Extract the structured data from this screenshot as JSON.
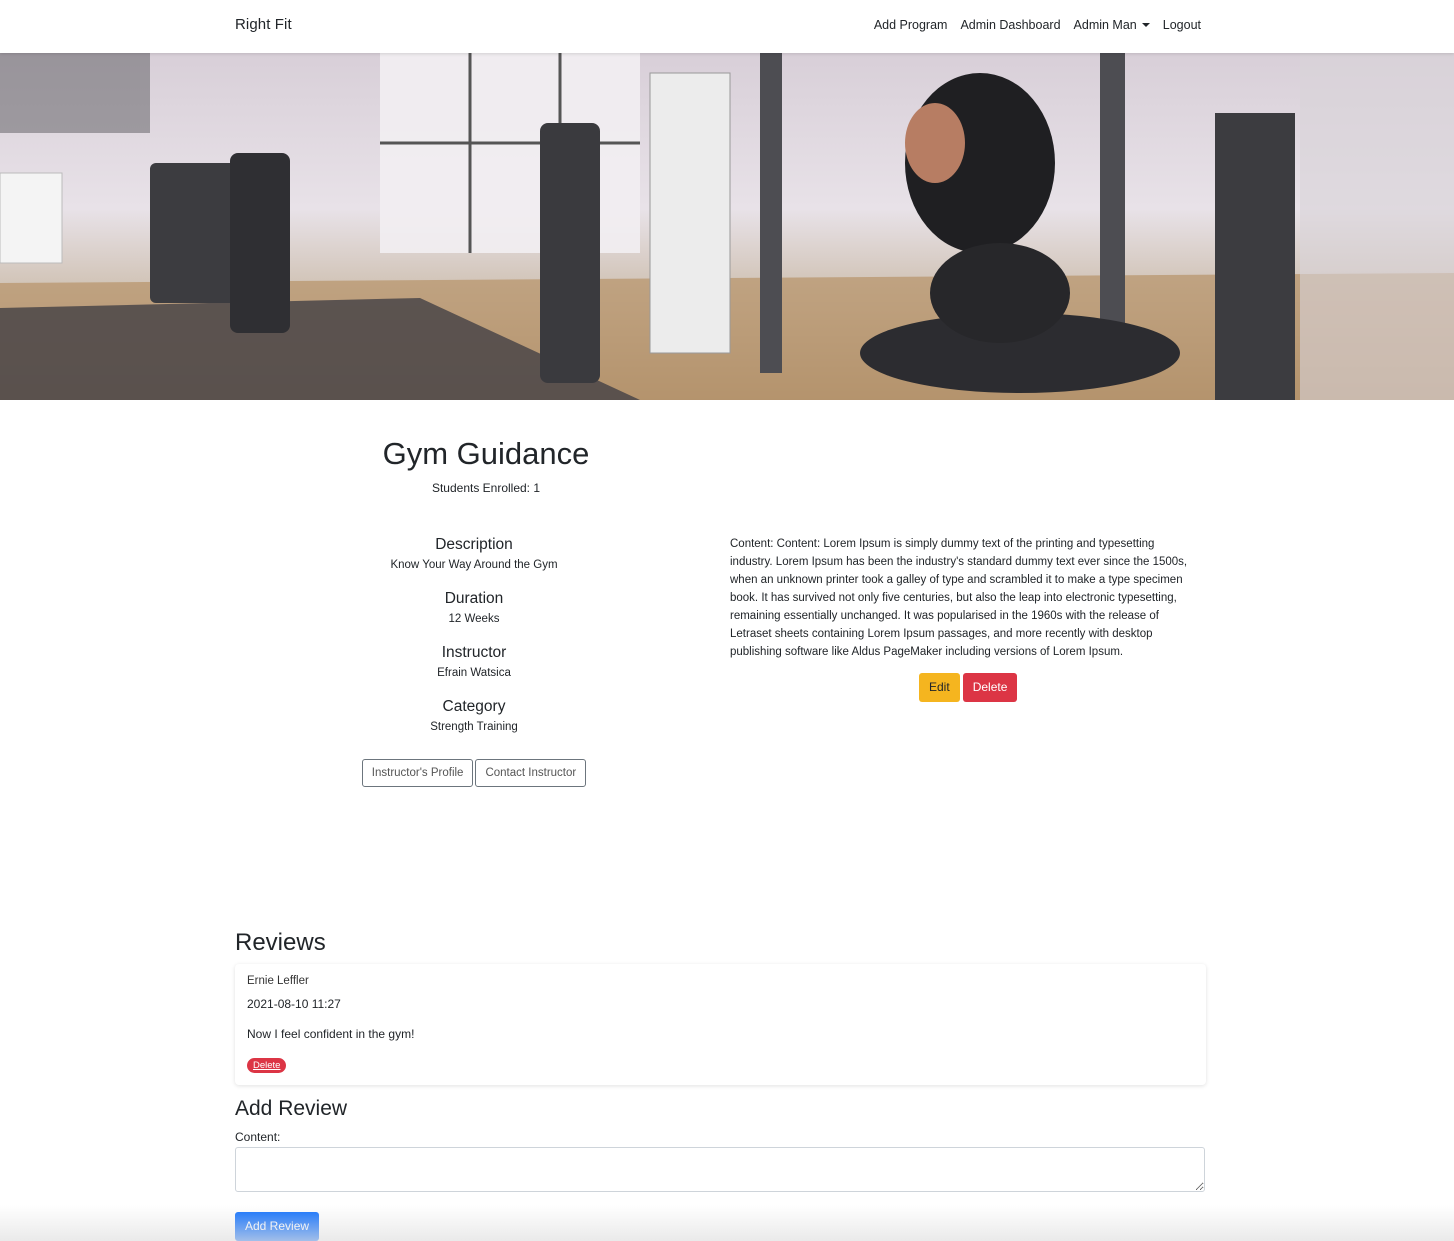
{
  "navbar": {
    "brand": "Right Fit",
    "links": [
      "Add Program",
      "Admin Dashboard",
      "Admin Man",
      "Logout"
    ]
  },
  "program": {
    "title": "Gym Guidance",
    "students_enrolled": "Students Enrolled: 1",
    "details": [
      {
        "label": "Description",
        "value": "Know Your Way Around the Gym"
      },
      {
        "label": "Duration",
        "value": "12 Weeks"
      },
      {
        "label": "Instructor",
        "value": "Efrain Watsica"
      },
      {
        "label": "Category",
        "value": "Strength Training"
      }
    ],
    "buttons": {
      "profile": "Instructor's Profile",
      "contact": "Contact Instructor"
    },
    "content": "Content: Content: Lorem Ipsum is simply dummy text of the printing and typesetting industry. Lorem Ipsum has been the industry's standard dummy text ever since the 1500s, when an unknown printer took a galley of type and scrambled it to make a type specimen book. It has survived not only five centuries, but also the leap into electronic typesetting, remaining essentially unchanged. It was popularised in the 1960s with the release of Letraset sheets containing Lorem Ipsum passages, and more recently with desktop publishing software like Aldus PageMaker including versions of Lorem Ipsum.",
    "actions": {
      "edit": "Edit",
      "delete": "Delete"
    }
  },
  "reviews": {
    "heading": "Reviews",
    "items": [
      {
        "author": "Ernie Leffler",
        "date": "2021-08-10 11:27",
        "text": "Now I feel confident in the gym!",
        "delete_label": "Delete"
      }
    ]
  },
  "add_review": {
    "heading": "Add Review",
    "content_label": "Content:",
    "textarea_value": "",
    "submit_label": "Add Review"
  },
  "colors": {
    "primary": "#0d6efd",
    "danger": "#dc3545",
    "warning": "#f5b51f"
  },
  "icons": {
    "user_dropdown": "chevron-down-icon"
  }
}
